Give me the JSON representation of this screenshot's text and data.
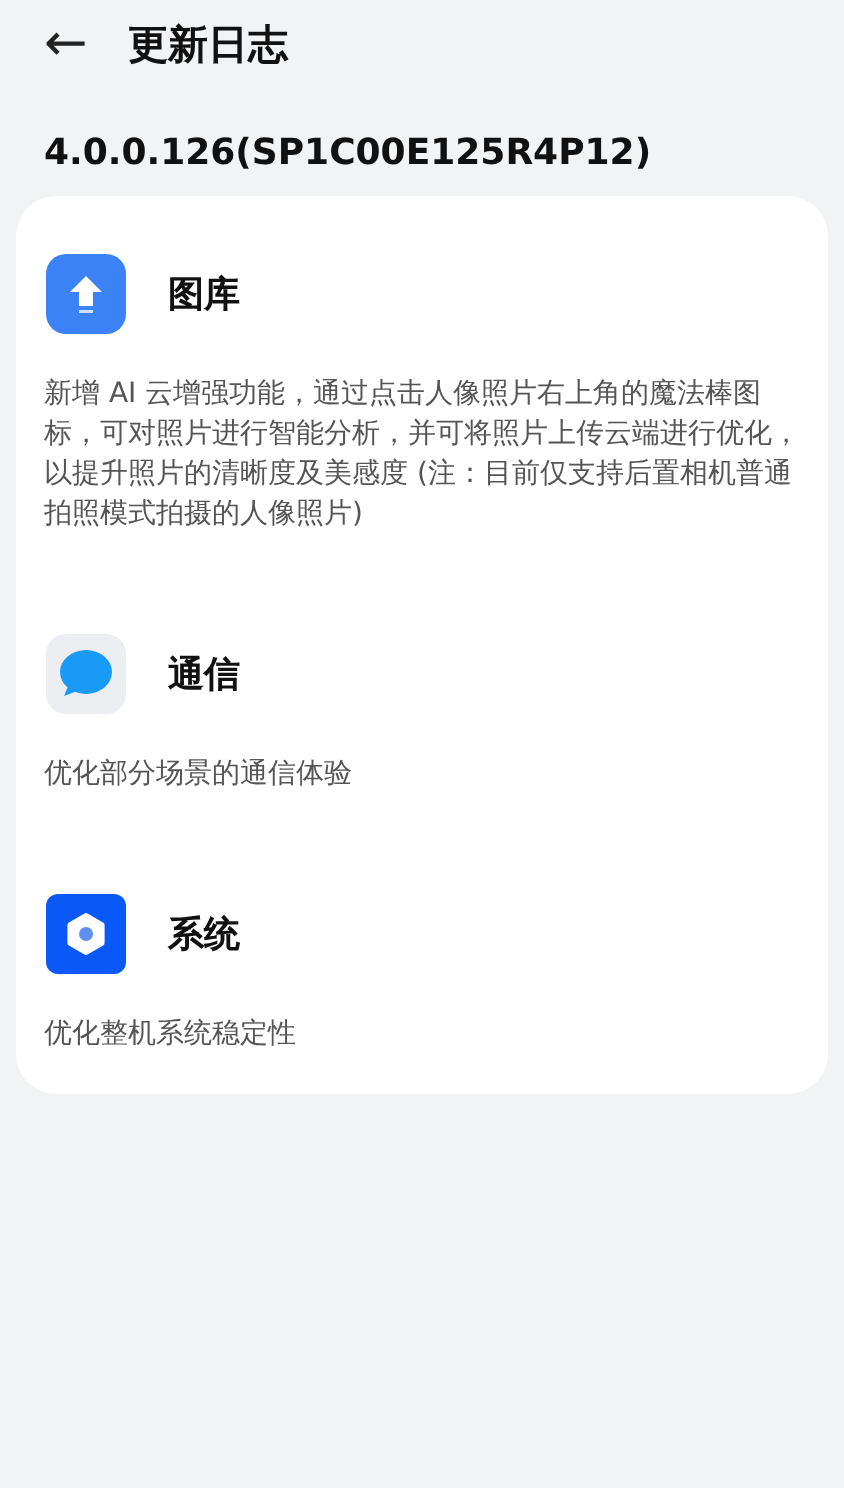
{
  "header": {
    "back_icon": "←",
    "title": "更新日志"
  },
  "version": "4.0.0.126(SP1C00E125R4P12)",
  "sections": [
    {
      "kind": "gallery",
      "title": "图库",
      "description": "新增 AI 云增强功能，通过点击人像照片右上角的魔法棒图标，可对照片进行智能分析，并可将照片上传云端进行优化，以提升照片的清晰度及美感度 (注：目前仅支持后置相机普通拍照模式拍摄的人像照片)"
    },
    {
      "kind": "messaging",
      "title": "通信",
      "description": "优化部分场景的通信体验"
    },
    {
      "kind": "system",
      "title": "系统",
      "description": "优化整机系统稳定性"
    }
  ]
}
